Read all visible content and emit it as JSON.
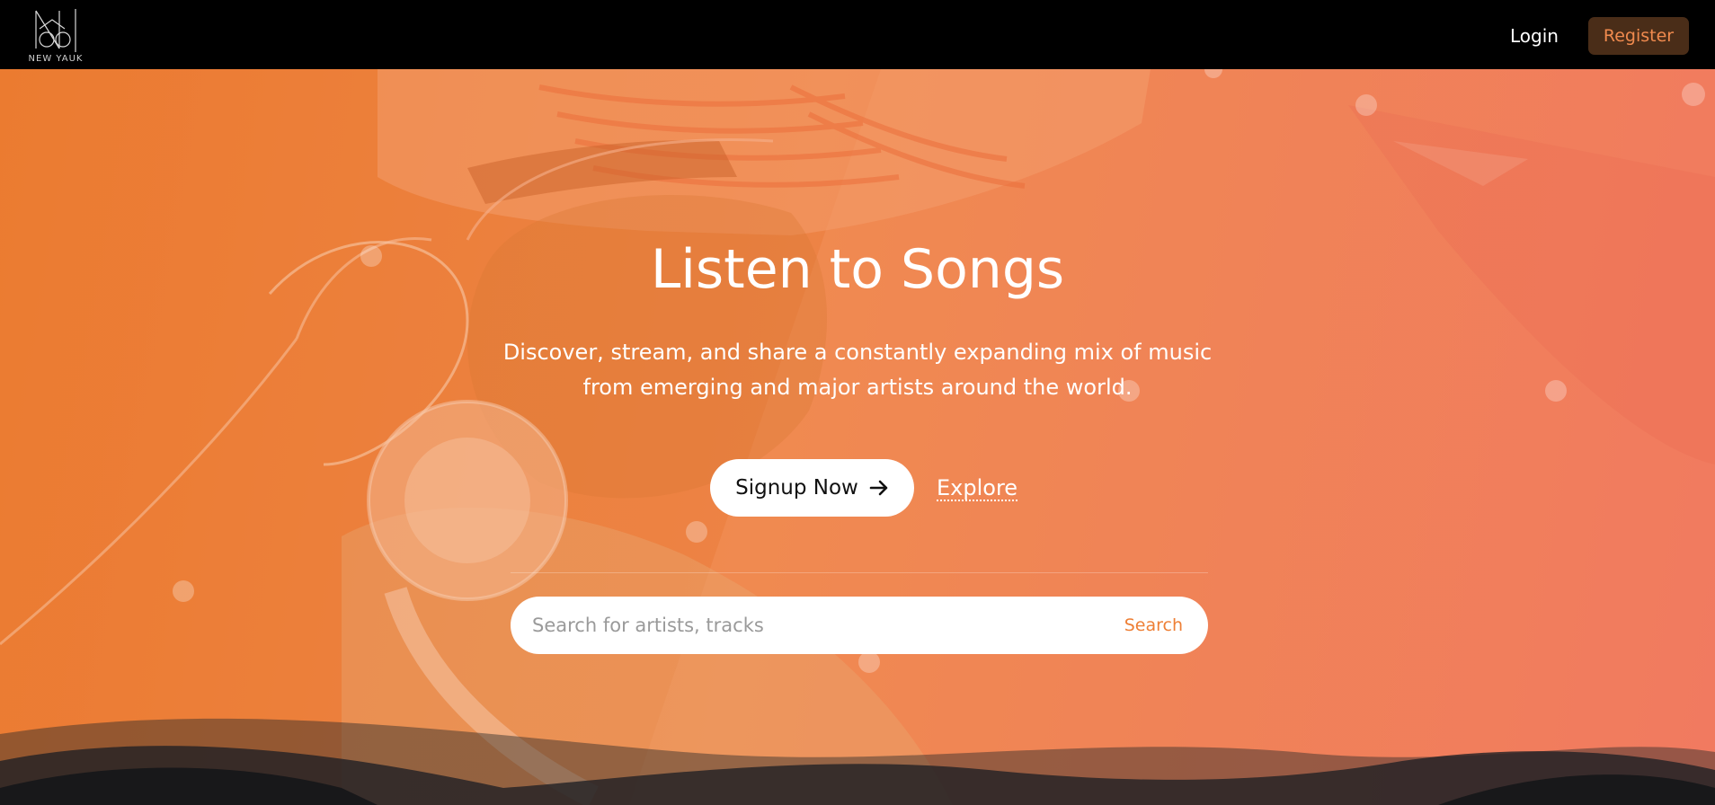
{
  "nav": {
    "logo_text": "NEW YAUK",
    "login": "Login",
    "register": "Register"
  },
  "hero": {
    "title": "Listen to Songs",
    "description": "Discover, stream, and share a constantly expanding mix of music from emerging and major artists around the world.",
    "signup_label": "Signup Now",
    "explore_label": "Explore",
    "search": {
      "placeholder": "Search for artists, tracks",
      "button_label": "Search"
    }
  },
  "icons": {
    "signup": "arrow-right-icon",
    "brand": "new-yauk-logo-icon"
  },
  "colors": {
    "accent": "#ee7f35",
    "hero_start": "#ee7f35",
    "hero_end": "#f17a60",
    "register_bg": "#4a2d18",
    "navbar_bg": "#000000"
  }
}
